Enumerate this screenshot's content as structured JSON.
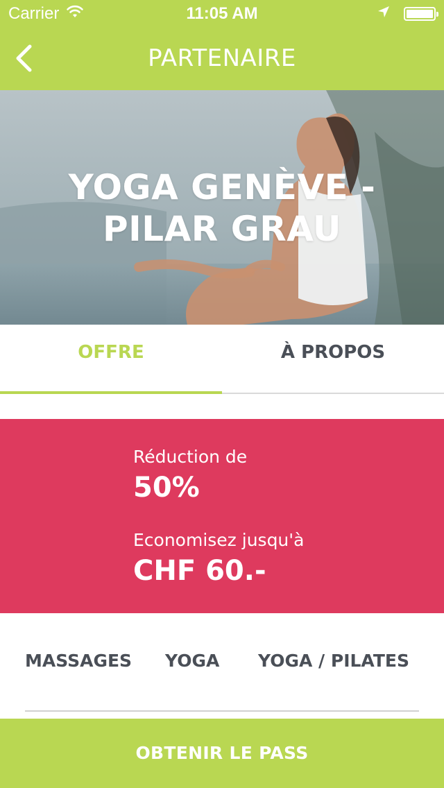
{
  "status_bar": {
    "carrier": "Carrier",
    "time": "11:05 AM",
    "icons": [
      "wifi-icon",
      "location-arrow-icon",
      "battery-icon"
    ]
  },
  "nav": {
    "title": "PARTENAIRE",
    "back_icon": "chevron-left-icon"
  },
  "hero": {
    "title": "YOGA GENÈVE - PILAR GRAU"
  },
  "tabs": [
    {
      "label": "OFFRE",
      "active": true
    },
    {
      "label": "À PROPOS",
      "active": false
    }
  ],
  "offer": {
    "reduction_label": "Réduction de",
    "reduction_value": "50%",
    "savings_label": "Economisez jusqu'à",
    "savings_value": "CHF 60.-"
  },
  "categories": [
    "MASSAGES",
    "YOGA",
    "YOGA / PILATES"
  ],
  "cta": {
    "label": "OBTENIR LE PASS"
  },
  "colors": {
    "accent_green": "#b9d752",
    "offer_red": "#de3a5e",
    "dark_text": "#4a4f57"
  }
}
